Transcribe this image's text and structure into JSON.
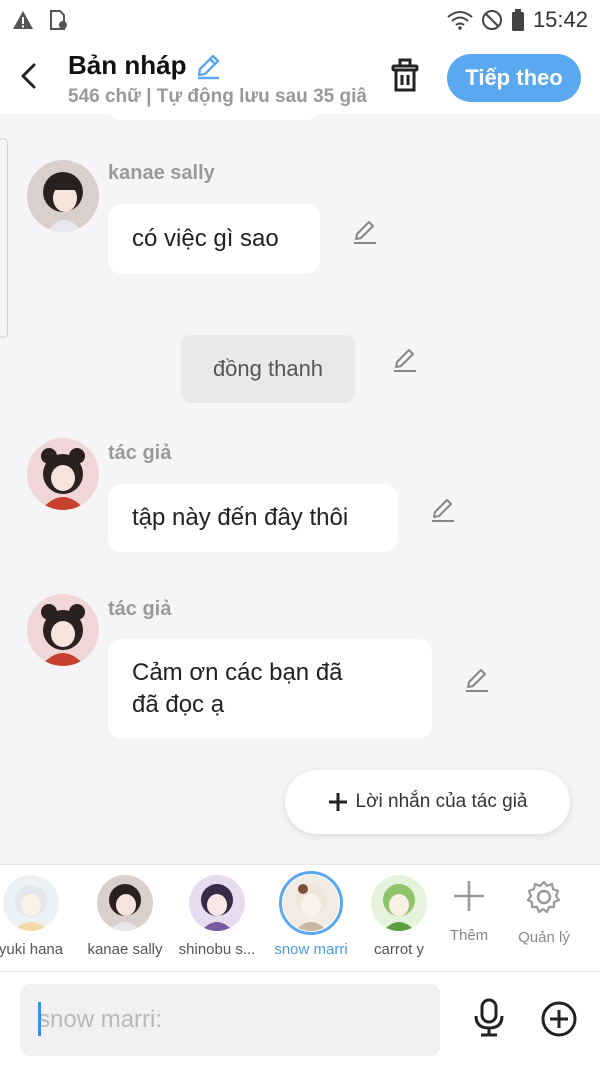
{
  "status": {
    "time": "15:42"
  },
  "header": {
    "title": "Bản nháp",
    "subtitle": "546 chữ | Tự động lưu sau 35 giâ",
    "next_label": "Tiếp theo"
  },
  "messages": [
    {
      "speaker": "kanae sally",
      "text": "có việc gì sao"
    },
    {
      "narration": "đồng thanh"
    },
    {
      "speaker": "tác giả",
      "text": "tập này đến đây thôi"
    },
    {
      "speaker": "tác giả",
      "line1": "Cảm ơn các bạn đã",
      "line2": "đã đọc ạ"
    }
  ],
  "author_note_label": "Lời nhắn của tác giả",
  "characters": [
    {
      "name": "yuki hana"
    },
    {
      "name": "kanae sally"
    },
    {
      "name": "shinobu s..."
    },
    {
      "name": "snow marri"
    },
    {
      "name": "carrot y"
    }
  ],
  "tools": {
    "add_label": "Thêm",
    "manage_label": "Quản lý"
  },
  "input": {
    "placeholder": "snow marri:"
  },
  "colors": {
    "accent": "#5aa8f0",
    "background": "#f5f5f7"
  }
}
